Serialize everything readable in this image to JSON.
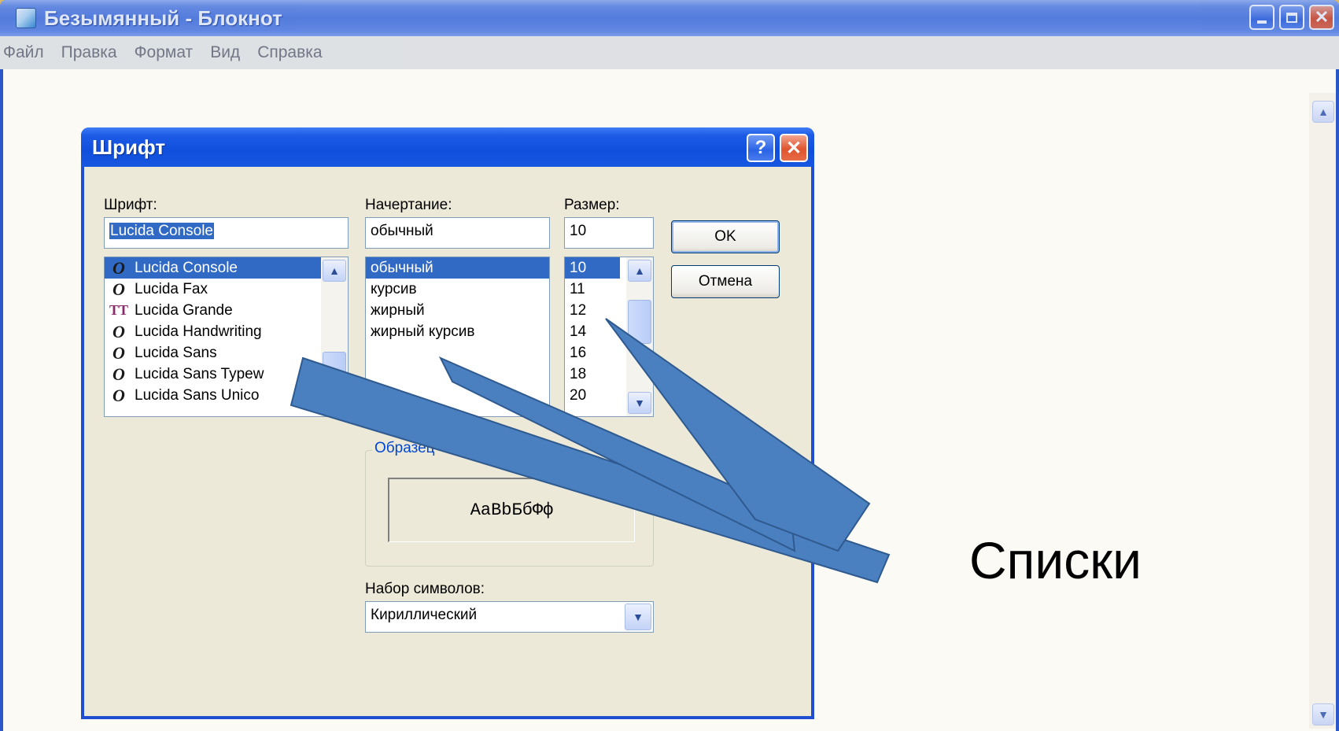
{
  "window": {
    "title": "Безымянный - Блокнот",
    "menu": [
      "Файл",
      "Правка",
      "Формат",
      "Вид",
      "Справка"
    ]
  },
  "dialog": {
    "title": "Шрифт",
    "help_glyph": "?",
    "close_glyph": "✕",
    "font": {
      "label": "Шрифт:",
      "value": "Lucida Console",
      "items": [
        {
          "name": "Lucida Console",
          "icon": "opentype-icon"
        },
        {
          "name": "Lucida Fax",
          "icon": "opentype-icon"
        },
        {
          "name": "Lucida Grande",
          "icon": "truetype-icon"
        },
        {
          "name": "Lucida Handwriting",
          "icon": "opentype-icon"
        },
        {
          "name": "Lucida Sans",
          "icon": "opentype-icon"
        },
        {
          "name": "Lucida Sans Typew",
          "icon": "opentype-icon"
        },
        {
          "name": "Lucida Sans Unico",
          "icon": "opentype-icon"
        }
      ],
      "selected_index": 0
    },
    "style": {
      "label": "Начертание:",
      "value": "обычный",
      "items": [
        "обычный",
        "курсив",
        "жирный",
        "жирный курсив"
      ],
      "selected_index": 0
    },
    "size": {
      "label": "Размер:",
      "value": "10",
      "items": [
        "10",
        "11",
        "12",
        "14",
        "16",
        "18",
        "20"
      ],
      "selected_index": 0
    },
    "ok_label": "OK",
    "cancel_label": "Отмена",
    "sample": {
      "label": "Образец",
      "text": "AaBbБбФф"
    },
    "charset": {
      "label": "Набор символов:",
      "value": "Кириллический"
    }
  },
  "callout": {
    "text": "Списки",
    "color": "#4a7fc0"
  },
  "colors": {
    "xp_blue": "#1f4fd0",
    "selection": "#316ac5",
    "dialog_face": "#ece9d8"
  }
}
